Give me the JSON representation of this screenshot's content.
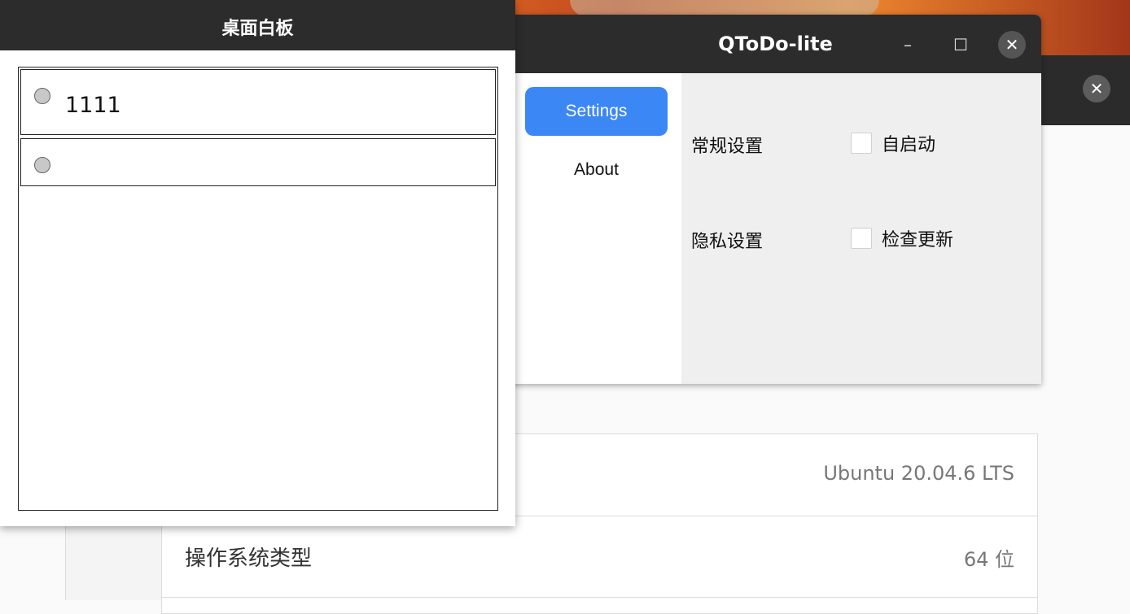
{
  "whiteboard": {
    "title": "桌面白板",
    "items": [
      {
        "text": "1111"
      },
      {
        "text": ""
      }
    ]
  },
  "qtodo": {
    "title": "QToDo-lite",
    "controls": {
      "minimize": "–",
      "maximize": "☐",
      "close": "✕"
    },
    "nav": {
      "settings": "Settings",
      "about": "About"
    },
    "settings": [
      {
        "label": "常规设置",
        "option": "自启动",
        "checked": false
      },
      {
        "label": "隐私设置",
        "option": "检查更新",
        "checked": false
      }
    ]
  },
  "background_window": {
    "close": "✕",
    "rows": [
      {
        "label": "",
        "value": "Ubuntu 20.04.6 LTS"
      },
      {
        "label": "操作系统类型",
        "value": "64 位"
      }
    ]
  },
  "colors": {
    "accent": "#3b87f5",
    "titlebar": "#2c2c2c"
  }
}
